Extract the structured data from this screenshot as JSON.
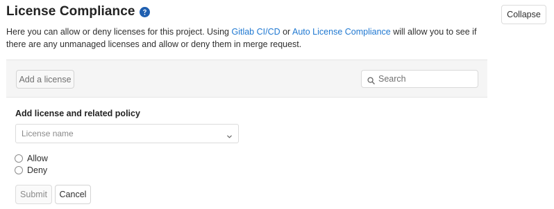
{
  "header": {
    "title": "License Compliance",
    "help_icon": "question-circle-icon",
    "collapse_label": "Collapse"
  },
  "description": {
    "text_1": "Here you can allow or deny licenses for this project. Using ",
    "link_1": "Gitlab CI/CD",
    "text_2": " or ",
    "link_2": "Auto License Compliance",
    "text_3": " will allow you to see if there are any unmanaged licenses and allow or deny them in merge request."
  },
  "toolbar": {
    "add_license_label": "Add a license",
    "search_placeholder": "Search",
    "search_icon": "search-icon"
  },
  "form": {
    "label": "Add license and related policy",
    "license_select_placeholder": "License name",
    "options": [
      {
        "label": "Allow"
      },
      {
        "label": "Deny"
      }
    ],
    "submit_label": "Submit",
    "cancel_label": "Cancel"
  },
  "colors": {
    "link": "#1f78d1",
    "help_icon": "#1f5fb0",
    "toolbar_bg": "#f5f5f5"
  }
}
